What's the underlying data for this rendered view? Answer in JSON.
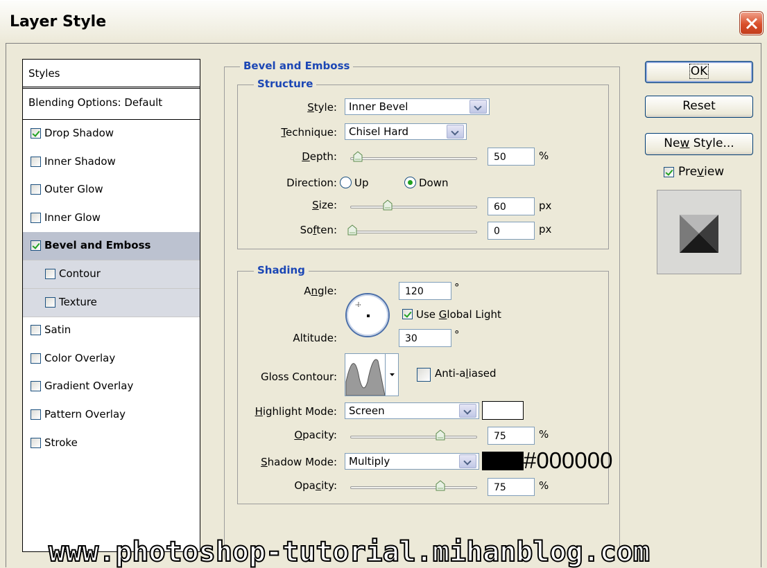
{
  "window": {
    "title": "Layer Style"
  },
  "styles_list": {
    "header": "Styles",
    "blending": "Blending Options: Default",
    "items": [
      {
        "label": "Drop Shadow",
        "checked": true
      },
      {
        "label": "Inner Shadow",
        "checked": false
      },
      {
        "label": "Outer Glow",
        "checked": false
      },
      {
        "label": "Inner Glow",
        "checked": false
      },
      {
        "label": "Bevel and Emboss",
        "checked": true,
        "selected": true
      },
      {
        "label": "Contour",
        "checked": false,
        "sub": true
      },
      {
        "label": "Texture",
        "checked": false,
        "sub": true
      },
      {
        "label": "Satin",
        "checked": false
      },
      {
        "label": "Color Overlay",
        "checked": false
      },
      {
        "label": "Gradient Overlay",
        "checked": false
      },
      {
        "label": "Pattern Overlay",
        "checked": false
      },
      {
        "label": "Stroke",
        "checked": false
      }
    ]
  },
  "bevel": {
    "title": "Bevel and Emboss",
    "structure": {
      "title": "Structure",
      "style_label_pre": "",
      "style_label_u": "S",
      "style_label_post": "tyle:",
      "style_value": "Inner Bevel",
      "technique_u": "T",
      "technique_post": "echnique:",
      "technique_value": "Chisel Hard",
      "depth_u": "D",
      "depth_post": "epth:",
      "depth_value": "50",
      "depth_level": 0.05,
      "depth_unit": "%",
      "direction_label": "Direction:",
      "dir_up": "Up",
      "dir_down": "Down",
      "size_u": "S",
      "size_post": "ize:",
      "size_value": "60",
      "size_level": 0.3,
      "size_unit": "px",
      "soften_pre": "So",
      "soften_u": "f",
      "soften_post": "ten:",
      "soften_value": "0",
      "soften_level": 0.0,
      "soften_unit": "px"
    },
    "shading": {
      "title": "Shading",
      "angle_pre": "A",
      "angle_u": "n",
      "angle_post": "gle:",
      "angle_value": "120",
      "degree": "°",
      "use_global_pre": "Use ",
      "use_global_u": "G",
      "use_global_post": "lobal Light",
      "altitude_label": "Altitude:",
      "altitude_value": "30",
      "gloss_label": "Gloss Contour:",
      "anti_pre": "Anti-a",
      "anti_u": "l",
      "anti_post": "iased",
      "highlight_u": "H",
      "highlight_post": "ighlight Mode:",
      "highlight_value": "Screen",
      "highlight_color": "#ffffff",
      "h_opacity_u": "O",
      "h_opacity_post": "pacity:",
      "h_opacity_value": "75",
      "h_opacity_level": 0.75,
      "percent": "%",
      "shadow_u": "S",
      "shadow_post": "hadow Mode:",
      "shadow_value": "Multiply",
      "shadow_color": "#000000",
      "shadow_hex_label": "#000000",
      "s_opacity_pre": "Opa",
      "s_opacity_u": "c",
      "s_opacity_post": "ity:",
      "s_opacity_value": "75",
      "s_opacity_level": 0.75
    }
  },
  "buttons": {
    "ok": "OK",
    "reset": "Reset",
    "new_style_pre": "Ne",
    "new_style_u": "w",
    "new_style_post": " Style...",
    "preview_pre": "Pre",
    "preview_u": "v",
    "preview_post": "iew"
  },
  "watermark": "www.photoshop-tutorial.mihanblog.com"
}
